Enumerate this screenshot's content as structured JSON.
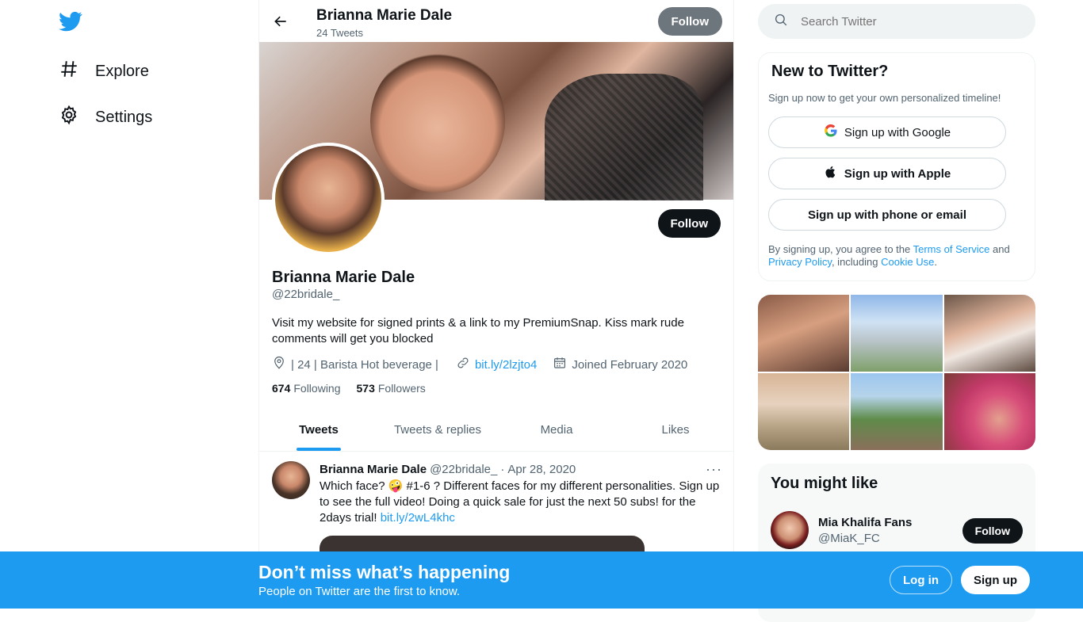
{
  "nav": {
    "logo_icon": "twitter-bird-icon",
    "items": [
      {
        "label": "Explore",
        "icon": "hashtag-icon"
      },
      {
        "label": "Settings",
        "icon": "gear-icon"
      }
    ]
  },
  "header": {
    "name": "Brianna Marie Dale",
    "tweet_count": "24 Tweets",
    "follow_label": "Follow"
  },
  "profile": {
    "name": "Brianna Marie Dale",
    "handle": "@22bridale_",
    "follow_label": "Follow",
    "bio": "Visit my website for signed prints & a link to my PremiumSnap. Kiss mark rude comments will get you blocked",
    "location": "| 24 | Barista Hot beverage |",
    "link": "bit.ly/2lzjto4",
    "joined": "Joined February 2020",
    "following_count": "674",
    "following_label": "Following",
    "followers_count": "573",
    "followers_label": "Followers"
  },
  "tabs": [
    "Tweets",
    "Tweets & replies",
    "Media",
    "Likes"
  ],
  "tweet": {
    "name": "Brianna Marie Dale",
    "handle": "@22bridale_",
    "separator": "·",
    "date": "Apr 28, 2020",
    "more": "···",
    "text": "Which face? 🤪 #1-6 ? Different faces for my different personalities. Sign up to see the full video! Doing a quick sale for just the next 50 subs! for the 2days trial! ",
    "link": "bit.ly/2wL4khc"
  },
  "search": {
    "placeholder": "Search Twitter"
  },
  "signup": {
    "title": "New to Twitter?",
    "subtitle": "Sign up now to get your own personalized timeline!",
    "google": "Sign up with Google",
    "apple": "Sign up with Apple",
    "phone": "Sign up with phone or email",
    "legal_1": "By signing up, you agree to the ",
    "terms": "Terms of Service",
    "legal_2": " and ",
    "privacy": "Privacy Policy",
    "legal_3": ", including ",
    "cookie": "Cookie Use",
    "legal_4": "."
  },
  "you_might_like": {
    "title": "You might like",
    "name": "Mia Khalifa Fans",
    "handle": "@MiaK_FC",
    "follow_label": "Follow"
  },
  "bottom_bar": {
    "title": "Don’t miss what’s happening",
    "subtitle": "People on Twitter are the first to know.",
    "login": "Log in",
    "signup": "Sign up"
  },
  "colors": {
    "accent": "#1d9bf0",
    "text": "#0f1419",
    "muted": "#536471"
  }
}
